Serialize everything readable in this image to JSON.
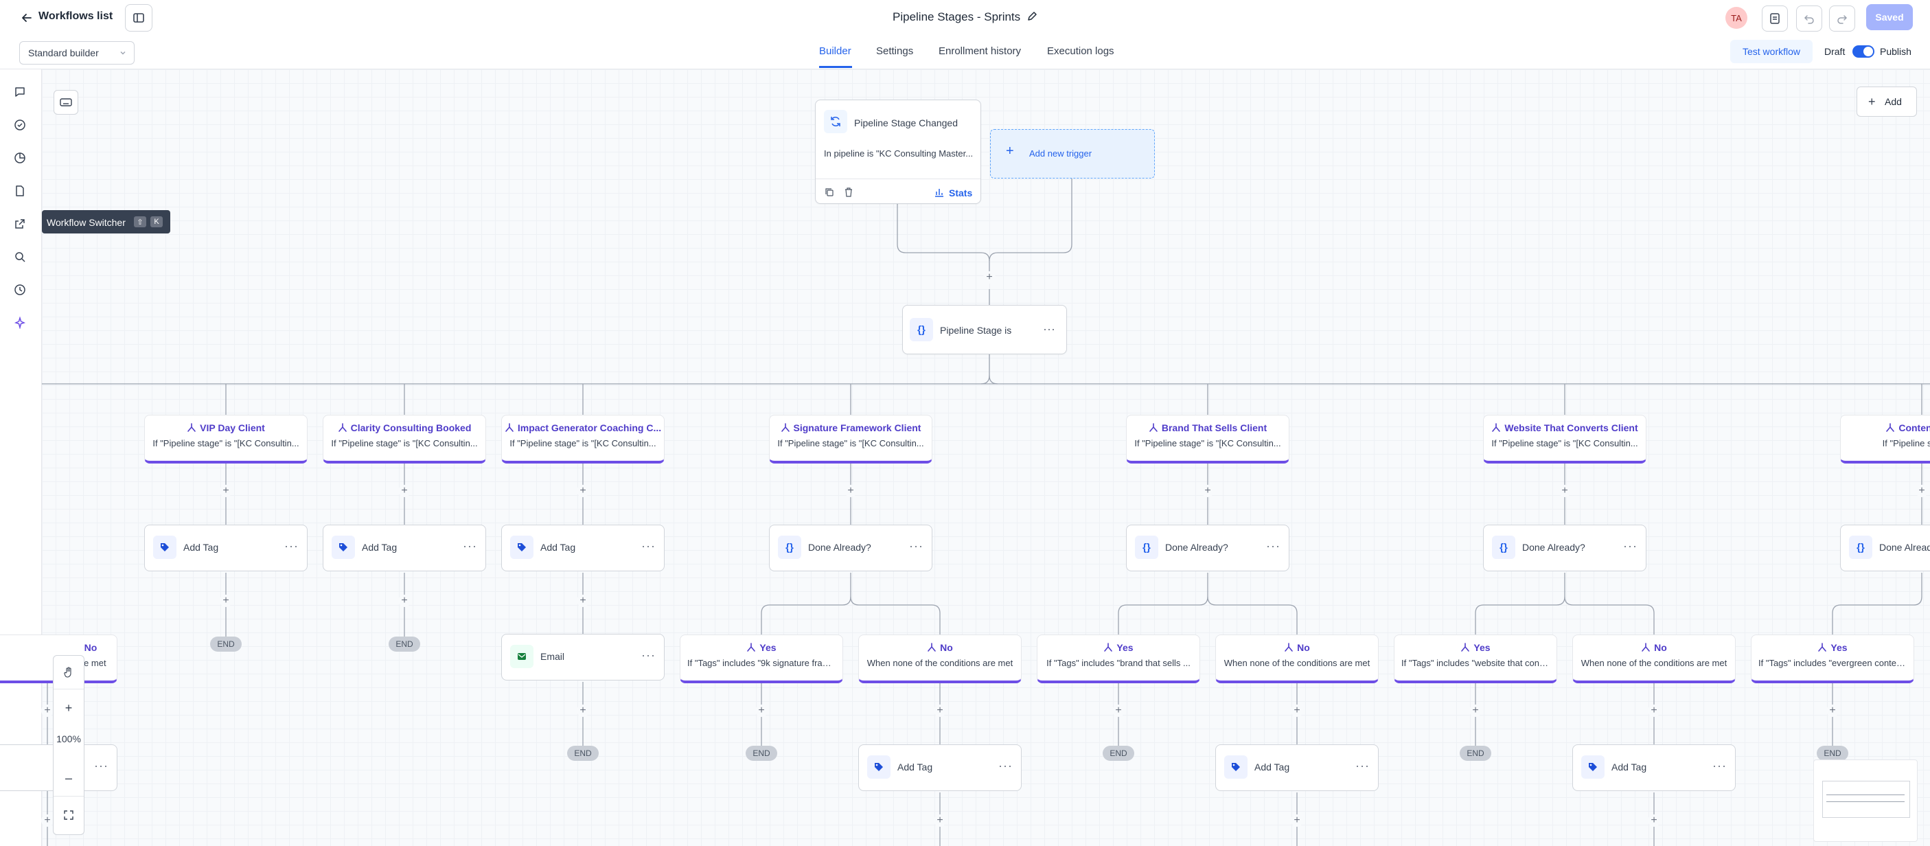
{
  "header": {
    "back_label": "Workflows list",
    "title": "Pipeline Stages - Sprints",
    "avatar_initials": "TA",
    "saved_label": "Saved"
  },
  "subbar": {
    "builder_select": "Standard builder",
    "tabs": [
      "Builder",
      "Settings",
      "Enrollment history",
      "Execution logs"
    ],
    "active_tab": "Builder",
    "test_workflow": "Test workflow",
    "draft_label": "Draft",
    "publish_label": "Publish",
    "publish_on": true
  },
  "tooltip": {
    "label": "Workflow Switcher",
    "key1": "⇧",
    "key2": "K"
  },
  "canvas": {
    "add_label": "Add",
    "zoom": "100%"
  },
  "trigger": {
    "title": "Pipeline Stage Changed",
    "detail": "In pipeline is \"KC Consulting Master...",
    "stats_label": "Stats",
    "add_trigger": "Add new trigger"
  },
  "condition_node": {
    "label": "Pipeline Stage is"
  },
  "branches": [
    {
      "title": "VIP Day Client",
      "detail": "If \"Pipeline stage\" is \"[KC Consultin..."
    },
    {
      "title": "Clarity Consulting Booked",
      "detail": "If \"Pipeline stage\" is \"[KC Consultin..."
    },
    {
      "title": "Impact Generator Coaching C...",
      "detail": "If \"Pipeline stage\" is \"[KC Consultin..."
    },
    {
      "title": "Signature Framework Client",
      "detail": "If \"Pipeline stage\" is \"[KC Consultin..."
    },
    {
      "title": "Brand That Sells Client",
      "detail": "If \"Pipeline stage\" is \"[KC Consultin..."
    },
    {
      "title": "Website That Converts Client",
      "detail": "If \"Pipeline stage\" is \"[KC Consultin..."
    },
    {
      "title": "Content That",
      "detail": "If \"Pipeline stage\" is"
    }
  ],
  "actions_row1": [
    "Add Tag",
    "Add Tag",
    "Add Tag",
    "Done Already?",
    "Done Already?",
    "Done Already?",
    "Done Alread"
  ],
  "email_label": "Email",
  "end_label": "END",
  "sub_branches": [
    {
      "title": "No",
      "detail": "When none of the conditions are met"
    },
    {
      "title": "Yes",
      "detail": "If \"Tags\" includes \"9k signature fram..."
    },
    {
      "title": "No",
      "detail": "When none of the conditions are met"
    },
    {
      "title": "Yes",
      "detail": "If \"Tags\" includes \"brand that sells ..."
    },
    {
      "title": "No",
      "detail": "When none of the conditions are met"
    },
    {
      "title": "Yes",
      "detail": "If \"Tags\" includes \"website that conv..."
    },
    {
      "title": "No",
      "detail": "When none of the conditions are met"
    },
    {
      "title": "Yes",
      "detail": "If \"Tags\" includes \"evergreen content..."
    }
  ],
  "left_partial": {
    "title": "No",
    "detail": "e c s are met"
  },
  "actions_row2": [
    "Add Tag",
    "Add Tag",
    "Add Tag"
  ],
  "colors": {
    "accent": "#2563eb",
    "branch": "#6d4ee6",
    "saved_bg": "#a5b4fc"
  }
}
